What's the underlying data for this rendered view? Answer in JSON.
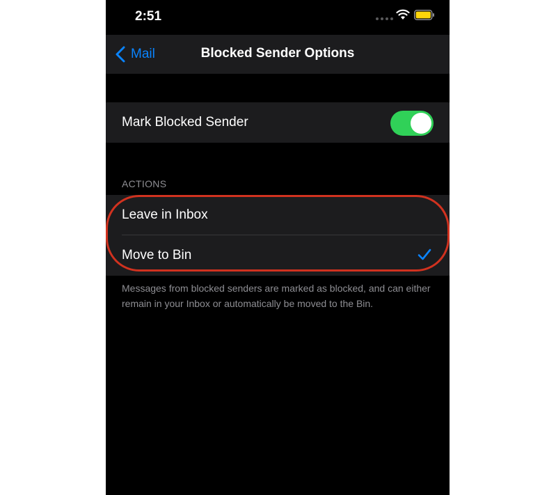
{
  "status_bar": {
    "time": "2:51",
    "icons": [
      "signal-icon",
      "wifi-icon",
      "battery-icon"
    ],
    "battery_color": "#ffd60a"
  },
  "nav": {
    "back_label": "Mail",
    "title": "Blocked Sender Options"
  },
  "mark_blocked": {
    "label": "Mark Blocked Sender",
    "enabled": true
  },
  "actions": {
    "header": "ACTIONS",
    "options": [
      {
        "label": "Leave in Inbox",
        "selected": false
      },
      {
        "label": "Move to Bin",
        "selected": true
      }
    ],
    "footer": "Messages from blocked senders are marked as blocked, and can either remain in your Inbox or automatically be moved to the Bin."
  },
  "colors": {
    "accent": "#0a84ff",
    "toggle_on": "#30d158",
    "highlight": "#d1321f",
    "background": "#000000",
    "cell": "#1c1c1e"
  }
}
